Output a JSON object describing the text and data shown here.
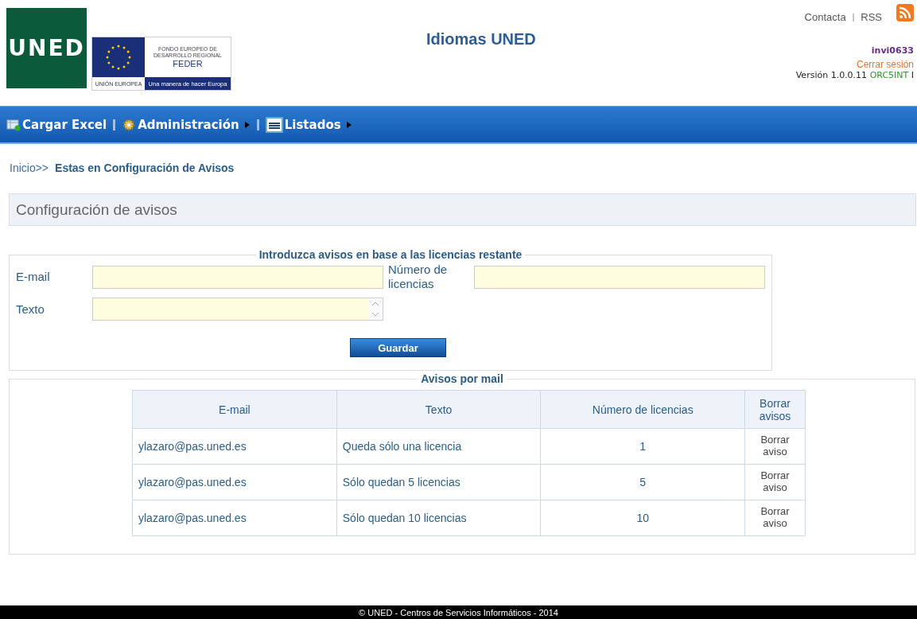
{
  "logo": {
    "text": "UNED"
  },
  "feder_logo": {
    "fund": "FONDO EUROPEO DE DESARROLLO REGIONAL",
    "name": "FEDER",
    "union": "UNIÓN EUROPEA",
    "motto": "Una manera de hacer Europa"
  },
  "site_title": "Idiomas UNED",
  "top_links": [
    "Contacta",
    "|",
    "RSS"
  ],
  "user": {
    "name": "invi0633",
    "logout": "Cerrar sesión",
    "version": "Versión 1.0.0.11",
    "server": "ORC5INT",
    "suffix": "I"
  },
  "menu": [
    {
      "label": "Cargar Excel",
      "kind": "excel",
      "submenu": false
    },
    {
      "label": "Administración",
      "kind": "gear",
      "submenu": true
    },
    {
      "label": "Listados",
      "kind": "list",
      "submenu": true
    }
  ],
  "breadcrumb": {
    "home": "Inicio>>",
    "current": "Estas en Configuración de Avisos"
  },
  "page_title": "Configuración de avisos",
  "form": {
    "legend": "Introduzca avisos en base a las licencias restante",
    "email_label": "E-mail",
    "licenses_label": "Número de licencias",
    "text_label": "Texto",
    "button": "Guardar"
  },
  "list": {
    "legend": "Avisos por mail",
    "columns": [
      "E-mail",
      "Texto",
      "Número de licencias",
      "Borrar avisos"
    ],
    "rows": [
      {
        "email": "ylazaro@pas.uned.es",
        "text": "Queda sólo una licencia",
        "licenses": "1",
        "action": "Borrar aviso"
      },
      {
        "email": "ylazaro@pas.uned.es",
        "text": "Sólo quedan 5 licencias",
        "licenses": "5",
        "action": "Borrar aviso"
      },
      {
        "email": "ylazaro@pas.uned.es",
        "text": "Sólo quedan 10 licencias",
        "licenses": "10",
        "action": "Borrar aviso"
      }
    ]
  },
  "footer": "© UNED - Centros de Servicios Informáticos - 2014"
}
